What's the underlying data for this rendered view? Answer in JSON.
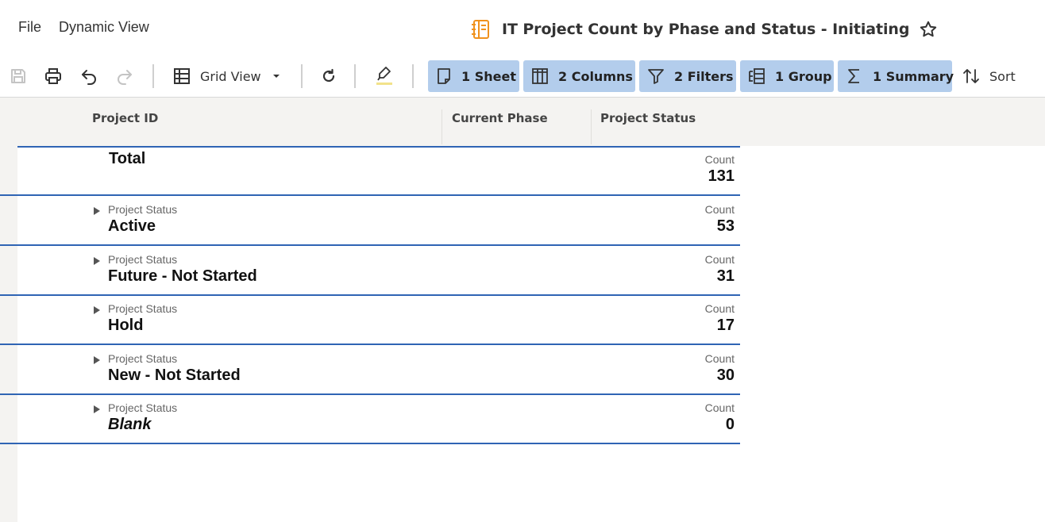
{
  "menu": {
    "file": "File",
    "dynamic_view": "Dynamic View"
  },
  "title": "IT Project Count by Phase and Status - Initiating",
  "toolbar": {
    "view_label": "Grid View",
    "sheet_label": "1 Sheet",
    "columns_label": "2 Columns",
    "filters_label": "2 Filters",
    "group_label": "1 Group",
    "summary_label": "1 Summary",
    "sort_label": "Sort"
  },
  "columns": [
    "Project ID",
    "Current Phase",
    "Project Status"
  ],
  "total": {
    "label": "Total",
    "count_label": "Count",
    "count": "131"
  },
  "groups": [
    {
      "group_label": "Project Status",
      "value": "Active",
      "count_label": "Count",
      "count": "53"
    },
    {
      "group_label": "Project Status",
      "value": "Future - Not Started",
      "count_label": "Count",
      "count": "31"
    },
    {
      "group_label": "Project Status",
      "value": "Hold",
      "count_label": "Count",
      "count": "17"
    },
    {
      "group_label": "Project Status",
      "value": "New - Not Started",
      "count_label": "Count",
      "count": "30"
    },
    {
      "group_label": "Project Status",
      "value": "Blank",
      "count_label": "Count",
      "count": "0"
    }
  ],
  "colors": {
    "accent_chip": "#b3cdec",
    "row_line": "#2f64b4",
    "title_icon": "#f0921e"
  },
  "icons": {
    "save": "save-icon",
    "print": "print-icon",
    "undo": "undo-icon",
    "redo": "redo-icon",
    "grid": "grid-icon",
    "refresh": "refresh-icon",
    "highlight": "highlighter-icon",
    "sheet": "sheet-icon",
    "columns": "columns-icon",
    "filter": "filter-icon",
    "group": "group-icon",
    "summary": "sigma-icon",
    "sort": "sort-icon",
    "favorite": "star-icon"
  }
}
